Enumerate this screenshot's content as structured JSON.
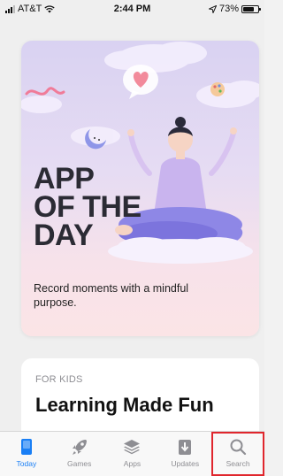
{
  "status_bar": {
    "carrier": "AT&T",
    "time": "2:44 PM",
    "battery": "73%",
    "battery_level": 0.73
  },
  "today": {
    "feature_card": {
      "title": "APP\nOF THE\nDAY",
      "subtitle": "Record moments with a mindful purpose."
    },
    "kids_card": {
      "eyebrow": "FOR KIDS",
      "title": "Learning Made Fun"
    }
  },
  "tab_bar": {
    "tabs": [
      {
        "label": "Today",
        "icon": "today-icon",
        "active": true
      },
      {
        "label": "Games",
        "icon": "rocket-icon",
        "active": false
      },
      {
        "label": "Apps",
        "icon": "layers-icon",
        "active": false
      },
      {
        "label": "Updates",
        "icon": "download-icon",
        "active": false
      },
      {
        "label": "Search",
        "icon": "search-icon",
        "active": false,
        "highlighted": true
      }
    ]
  },
  "colors": {
    "accent": "#1a7ff5",
    "inactive": "#8e8e93",
    "highlight_box": "#e0262d"
  }
}
